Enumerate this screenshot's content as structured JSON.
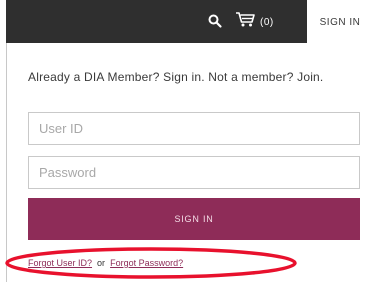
{
  "header": {
    "search_icon": "search-icon",
    "cart_icon": "cart-icon",
    "cart_count": "(0)",
    "signin_tab": "SIGN IN"
  },
  "login": {
    "prompt": "Already a DIA Member? Sign in. Not a member? Join.",
    "user_id_placeholder": "User ID",
    "user_id_value": "",
    "password_placeholder": "Password",
    "password_value": "",
    "signin_button": "SIGN IN",
    "forgot_user_id": "Forgot User ID?",
    "or_text": "or",
    "forgot_password": "Forgot Password?"
  },
  "colors": {
    "header_bg": "#2f2f2f",
    "accent": "#8e2c58",
    "highlight": "#e8112d"
  }
}
